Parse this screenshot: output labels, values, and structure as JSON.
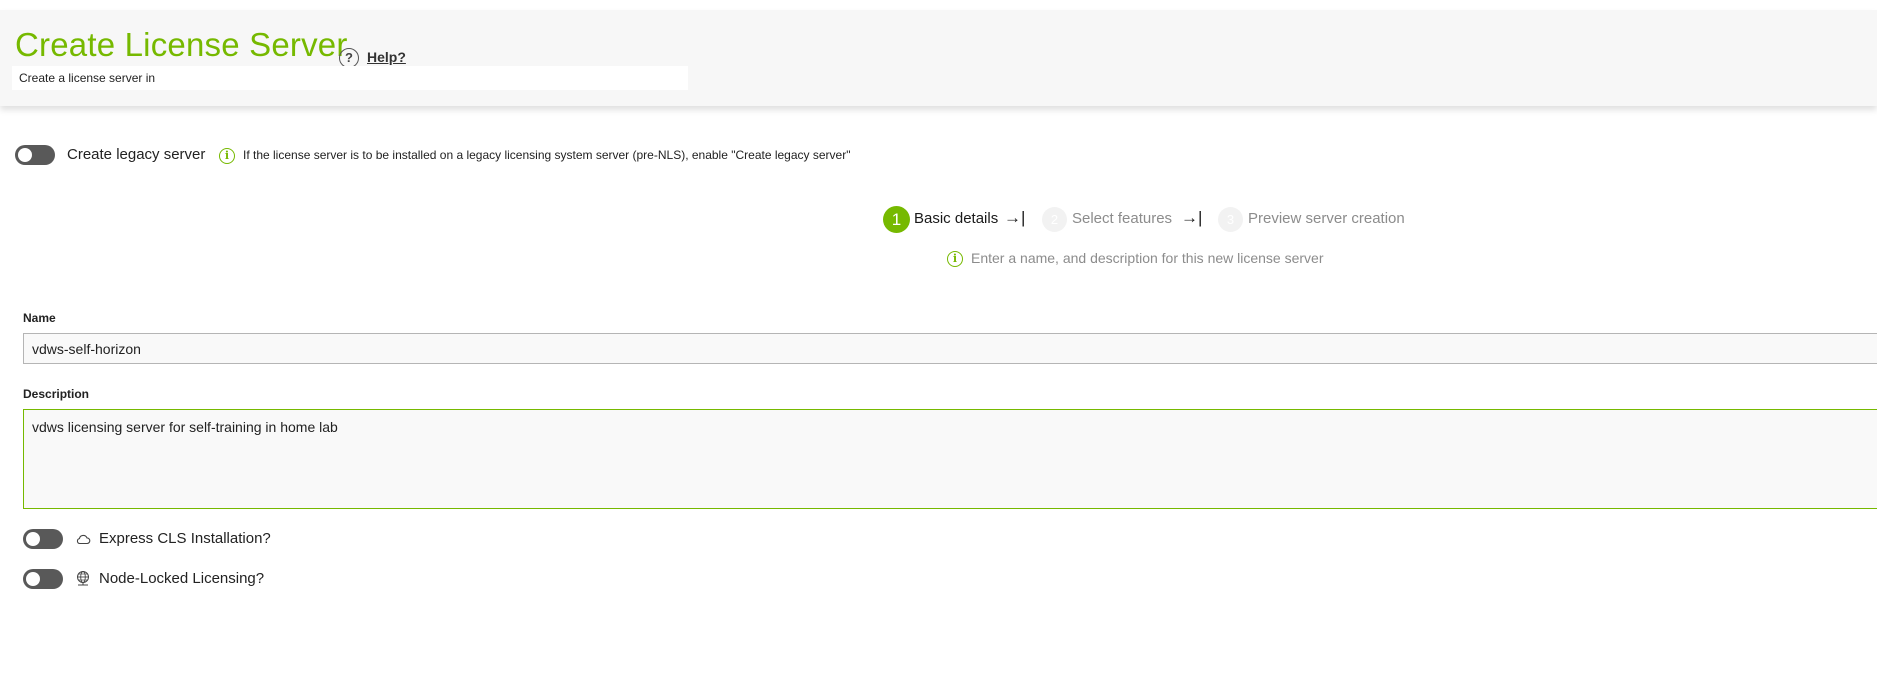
{
  "header": {
    "title": "Create License Server",
    "help_label": "Help?",
    "subtitle": "Create a license server in"
  },
  "legacy": {
    "label": "Create legacy server",
    "info": "If the license server is to be installed on a legacy licensing system server (pre-NLS), enable \"Create legacy server\"",
    "enabled": false
  },
  "stepper": {
    "steps": [
      {
        "number": "1",
        "label": "Basic details",
        "state": "active"
      },
      {
        "number": "2",
        "label": "Select features",
        "state": "inactive"
      },
      {
        "number": "3",
        "label": "Preview server creation",
        "state": "inactive"
      }
    ],
    "arrow": "→|",
    "hint": "Enter a name, and description for this new license server"
  },
  "form": {
    "name_label": "Name",
    "name_value": "vdws-self-horizon",
    "description_label": "Description",
    "description_value": "vdws licensing server for self-training in home lab"
  },
  "options": {
    "express": {
      "label": "Express CLS Installation?",
      "icon": "cloud-icon",
      "enabled": false
    },
    "node_locked": {
      "label": "Node-Locked Licensing?",
      "icon": "globe-icon",
      "enabled": false
    }
  },
  "colors": {
    "accent": "#76b900",
    "toggle_off": "#595959"
  }
}
